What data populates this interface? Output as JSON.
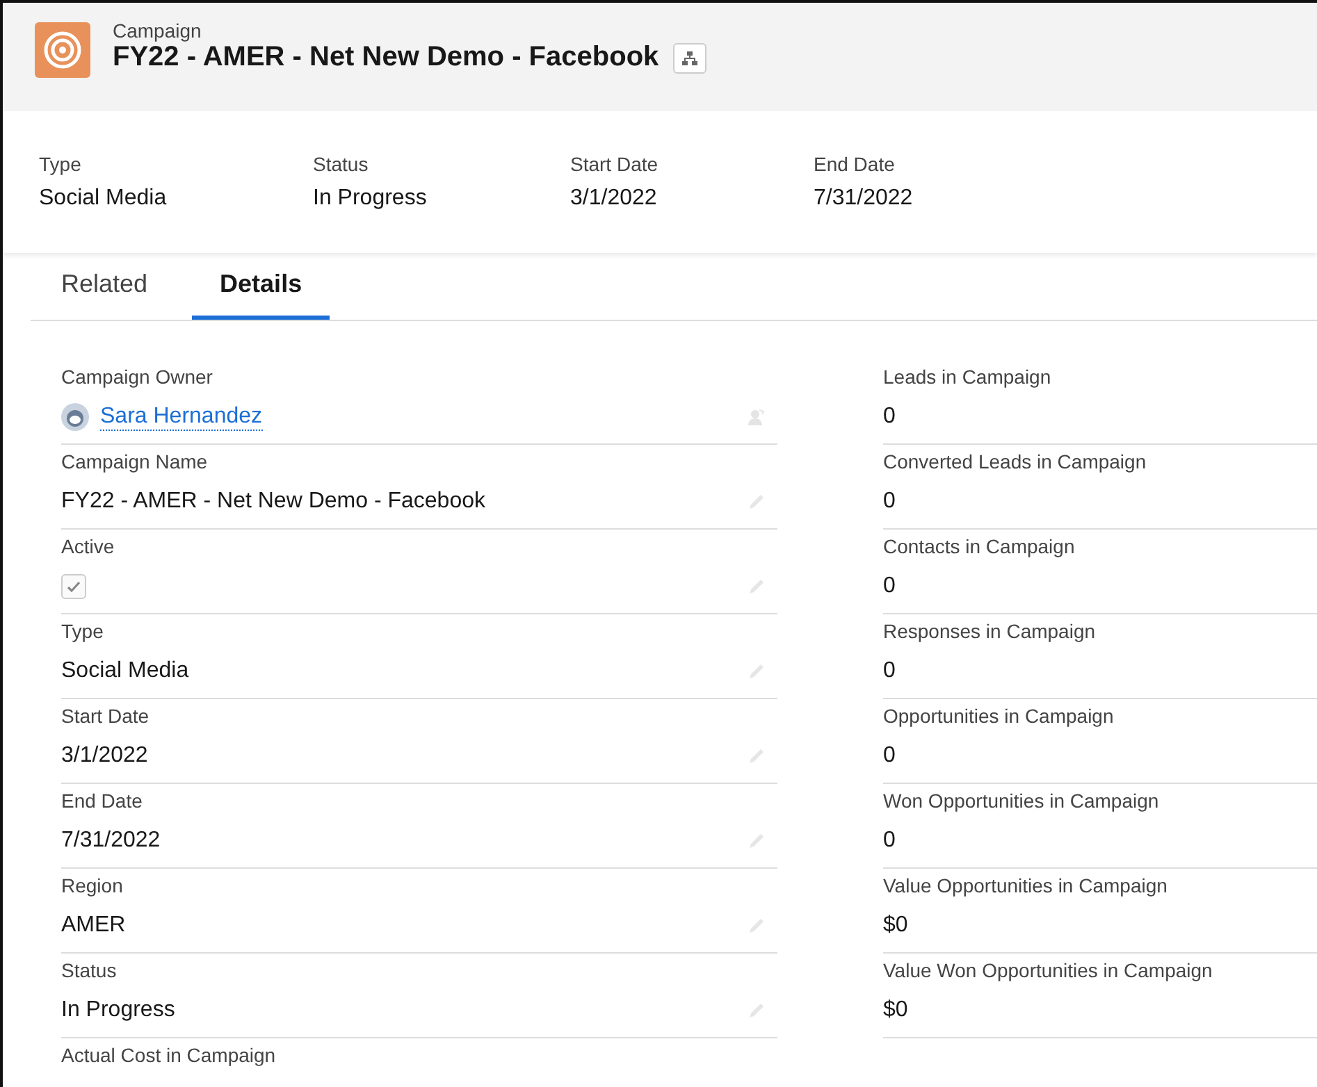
{
  "header": {
    "object_type": "Campaign",
    "title": "FY22 - AMER - Net New Demo - Facebook"
  },
  "highlights": [
    {
      "label": "Type",
      "value": "Social Media"
    },
    {
      "label": "Status",
      "value": "In Progress"
    },
    {
      "label": "Start Date",
      "value": "3/1/2022"
    },
    {
      "label": "End Date",
      "value": "7/31/2022"
    }
  ],
  "tabs": [
    {
      "label": "Related",
      "selected": false
    },
    {
      "label": "Details",
      "selected": true
    }
  ],
  "left_fields": [
    {
      "kind": "user",
      "label": "Campaign Owner",
      "value": "Sara Hernandez"
    },
    {
      "kind": "text",
      "label": "Campaign Name",
      "value": "FY22 - AMER - Net New Demo - Facebook"
    },
    {
      "kind": "checkbox",
      "label": "Active",
      "checked": true
    },
    {
      "kind": "text",
      "label": "Type",
      "value": "Social Media"
    },
    {
      "kind": "text",
      "label": "Start Date",
      "value": "3/1/2022"
    },
    {
      "kind": "text",
      "label": "End Date",
      "value": "7/31/2022"
    },
    {
      "kind": "text",
      "label": "Region",
      "value": "AMER"
    },
    {
      "kind": "text",
      "label": "Status",
      "value": "In Progress"
    },
    {
      "kind": "label",
      "label": "Actual Cost in Campaign"
    }
  ],
  "right_fields": [
    {
      "label": "Leads in Campaign",
      "value": "0"
    },
    {
      "label": "Converted Leads in Campaign",
      "value": "0"
    },
    {
      "label": "Contacts in Campaign",
      "value": "0"
    },
    {
      "label": "Responses in Campaign",
      "value": "0"
    },
    {
      "label": "Opportunities in Campaign",
      "value": "0"
    },
    {
      "label": "Won Opportunities in Campaign",
      "value": "0"
    },
    {
      "label": "Value Opportunities in Campaign",
      "value": "$0"
    },
    {
      "label": "Value Won Opportunities in Campaign",
      "value": "$0"
    }
  ]
}
